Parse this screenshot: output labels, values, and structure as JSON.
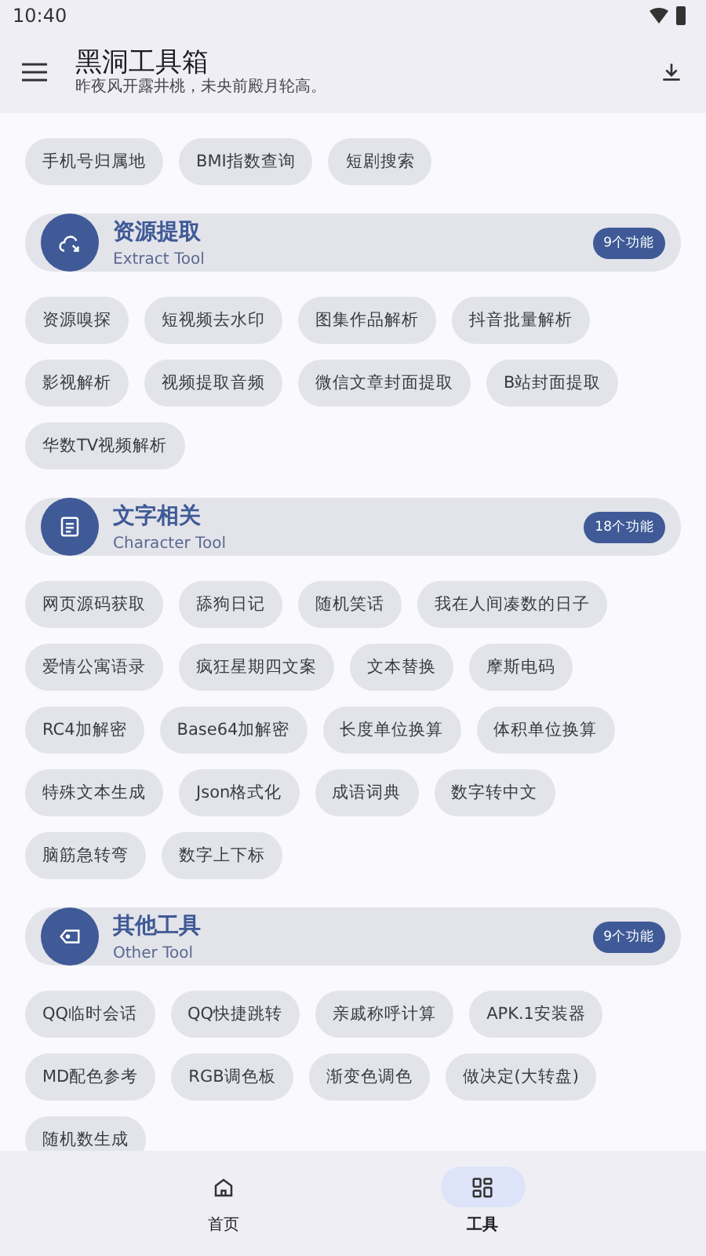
{
  "status_bar": {
    "time": "10:40"
  },
  "app_bar": {
    "title": "黑洞工具箱",
    "subtitle": "昨夜风开露井桃，未央前殿月轮高。"
  },
  "sections": [
    {
      "chips": [
        "手机号归属地",
        "BMI指数查询",
        "短剧搜索"
      ]
    },
    {
      "title": "资源提取",
      "subtitle": "Extract Tool",
      "count": "9个功能",
      "chips": [
        "资源嗅探",
        "短视频去水印",
        "图集作品解析",
        "抖音批量解析",
        "影视解析",
        "视频提取音频",
        "微信文章封面提取",
        "B站封面提取",
        "华数TV视频解析"
      ]
    },
    {
      "title": "文字相关",
      "subtitle": "Character Tool",
      "count": "18个功能",
      "chips": [
        "网页源码获取",
        "舔狗日记",
        "随机笑话",
        "我在人间凑数的日子",
        "爱情公寓语录",
        "疯狂星期四文案",
        "文本替换",
        "摩斯电码",
        "RC4加解密",
        "Base64加解密",
        "长度单位换算",
        "体积单位换算",
        "特殊文本生成",
        "Json格式化",
        "成语词典",
        "数字转中文",
        "脑筋急转弯",
        "数字上下标"
      ]
    },
    {
      "title": "其他工具",
      "subtitle": "Other Tool",
      "count": "9个功能",
      "chips": [
        "QQ临时会话",
        "QQ快捷跳转",
        "亲戚称呼计算",
        "APK.1安装器",
        "MD配色参考",
        "RGB调色板",
        "渐变色调色",
        "做决定(大转盘)",
        "随机数生成"
      ]
    }
  ],
  "nav": [
    {
      "label": "首页",
      "selected": false
    },
    {
      "label": "工具",
      "selected": true
    }
  ]
}
